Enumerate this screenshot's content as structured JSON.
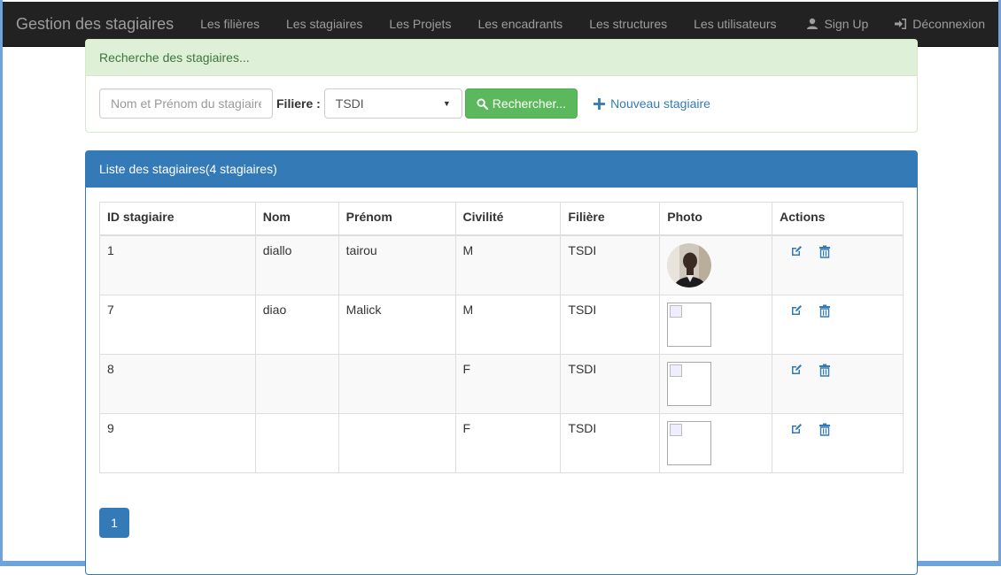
{
  "navbar": {
    "brand": "Gestion des stagiaires",
    "links": [
      "Les filières",
      "Les stagiaires",
      "Les Projets",
      "Les encadrants",
      "Les structures",
      "Les utilisateurs"
    ],
    "sign_up": "Sign Up",
    "logout": "Déconnexion"
  },
  "search": {
    "heading": "Recherche des stagiaires...",
    "placeholder": "Nom et Prénom du stagiaire",
    "filiere_label": "Filiere :",
    "filiere_value": "TSDI",
    "search_button": "Rechercher...",
    "new_link": "Nouveau stagiaire"
  },
  "list": {
    "heading": "Liste des stagiaires(4 stagiaires)",
    "columns": [
      "ID stagiaire",
      "Nom",
      "Prénom",
      "Civilité",
      "Filière",
      "Photo",
      "Actions"
    ],
    "rows": [
      {
        "id": "1",
        "nom": "diallo",
        "prenom": "tairou",
        "civilite": "M",
        "filiere": "TSDI",
        "photo": "avatar"
      },
      {
        "id": "7",
        "nom": "diao",
        "prenom": "Malick",
        "civilite": "M",
        "filiere": "TSDI",
        "photo": "broken"
      },
      {
        "id": "8",
        "nom": "",
        "prenom": "",
        "civilite": "F",
        "filiere": "TSDI",
        "photo": "broken"
      },
      {
        "id": "9",
        "nom": "",
        "prenom": "",
        "civilite": "F",
        "filiere": "TSDI",
        "photo": "broken"
      }
    ]
  },
  "pagination": {
    "current": "1"
  },
  "icons": {
    "user": "user-icon",
    "logout": "log-in-icon",
    "search": "search-icon",
    "plus": "plus-icon",
    "edit": "edit-icon",
    "delete": "trash-icon"
  },
  "colors": {
    "navbar": "#222222",
    "success": "#5cb85c",
    "primary": "#337ab7",
    "success_panel": "#dff0d8"
  }
}
